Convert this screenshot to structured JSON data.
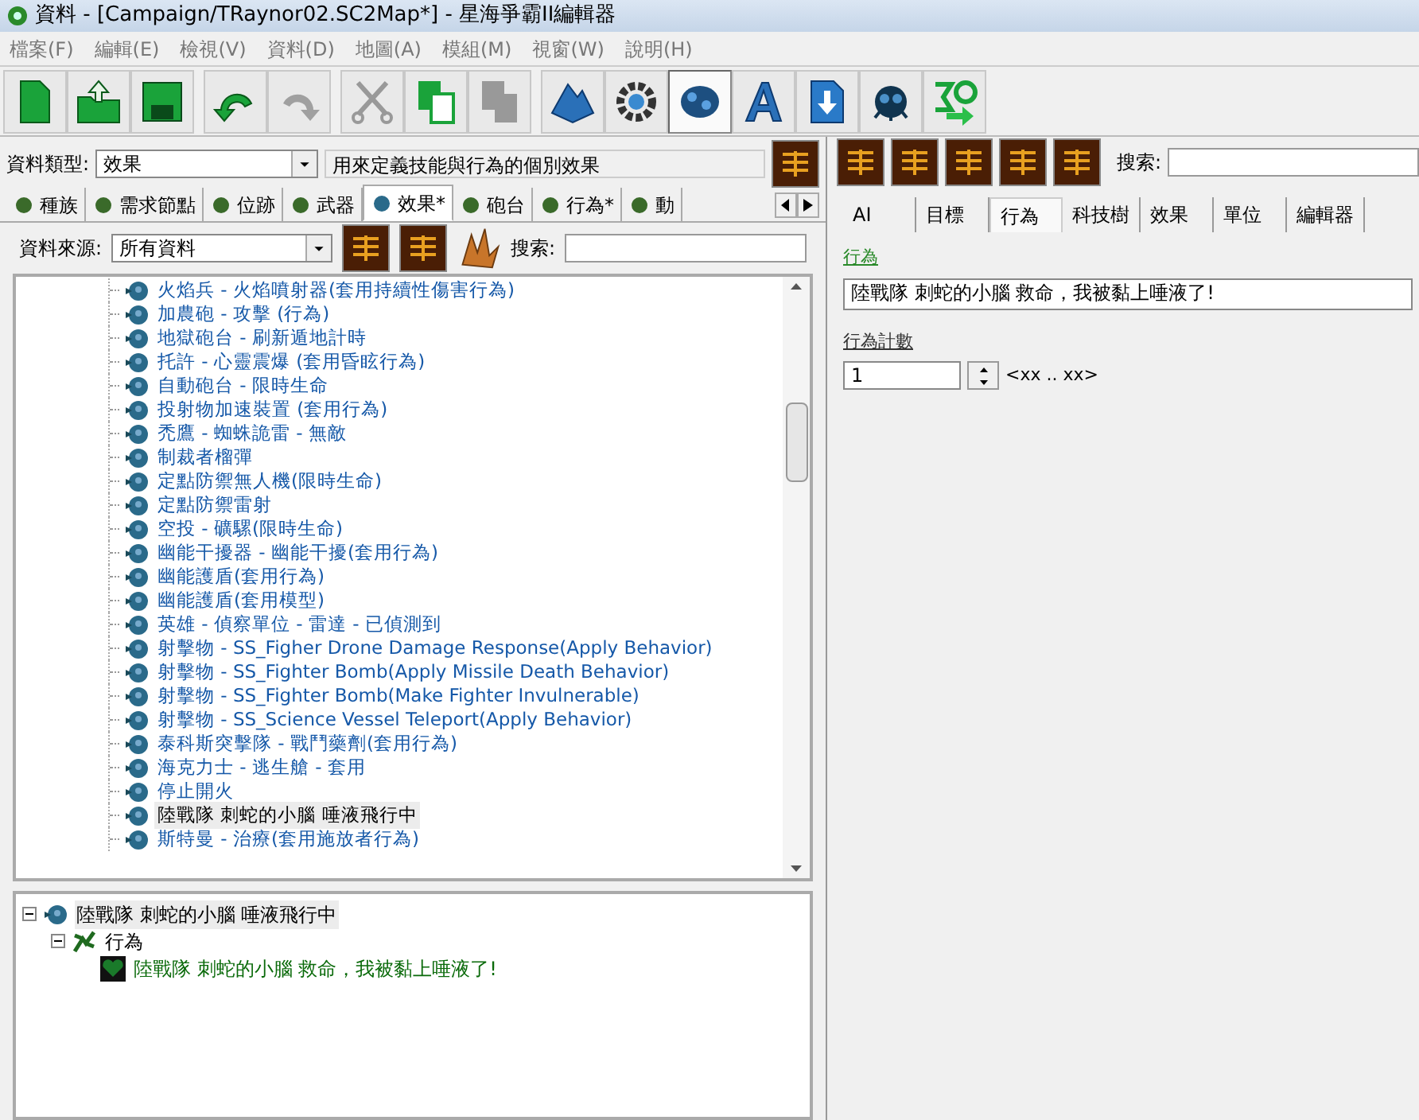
{
  "window": {
    "title": "資料 - [Campaign/TRaynor02.SC2Map*] - 星海爭霸II編輯器"
  },
  "menu": [
    "檔案(F)",
    "編輯(E)",
    "檢視(V)",
    "資料(D)",
    "地圖(A)",
    "模組(M)",
    "視窗(W)",
    "說明(H)"
  ],
  "toolbar": [
    {
      "kind": "new",
      "selected": false
    },
    {
      "kind": "open",
      "selected": false
    },
    {
      "kind": "save",
      "selected": false
    },
    {
      "kind": "undo",
      "selected": false
    },
    {
      "kind": "redo",
      "selected": false
    },
    {
      "kind": "cut",
      "selected": false
    },
    {
      "kind": "copy",
      "selected": false
    },
    {
      "kind": "paste",
      "selected": false
    },
    {
      "kind": "terrain",
      "selected": false
    },
    {
      "kind": "trigger",
      "selected": false
    },
    {
      "kind": "data",
      "selected": true
    },
    {
      "kind": "text",
      "selected": false
    },
    {
      "kind": "import",
      "selected": false
    },
    {
      "kind": "ai",
      "selected": false
    },
    {
      "kind": "launch",
      "selected": false
    }
  ],
  "data_type": {
    "label": "資料類型:",
    "value": "效果",
    "description": "用來定義技能與行為的個別效果"
  },
  "type_tabs": [
    {
      "label": "種族",
      "selected": false
    },
    {
      "label": "需求節點",
      "selected": false
    },
    {
      "label": "位跡",
      "selected": false
    },
    {
      "label": "武器",
      "selected": false
    },
    {
      "label": "效果*",
      "selected": true
    },
    {
      "label": "砲台",
      "selected": false
    },
    {
      "label": "行為*",
      "selected": false
    },
    {
      "label": "動",
      "selected": false
    }
  ],
  "data_source": {
    "label": "資料來源:",
    "value": "所有資料",
    "search_label": "搜索:"
  },
  "effect_list": [
    {
      "label": "火焰兵 - 火焰噴射器(套用持續性傷害行為)",
      "selected": false
    },
    {
      "label": "加農砲 - 攻擊 (行為)",
      "selected": false
    },
    {
      "label": "地獄砲台 - 刷新遁地計時",
      "selected": false
    },
    {
      "label": "托許 - 心靈震爆 (套用昏眩行為)",
      "selected": false
    },
    {
      "label": "自動砲台 - 限時生命",
      "selected": false
    },
    {
      "label": "投射物加速裝置 (套用行為)",
      "selected": false
    },
    {
      "label": "禿鷹 - 蜘蛛詭雷 - 無敵",
      "selected": false
    },
    {
      "label": "制裁者榴彈",
      "selected": false
    },
    {
      "label": "定點防禦無人機(限時生命)",
      "selected": false
    },
    {
      "label": "定點防禦雷射",
      "selected": false
    },
    {
      "label": "空投 - 礦騾(限時生命)",
      "selected": false
    },
    {
      "label": "幽能干擾器 - 幽能干擾(套用行為)",
      "selected": false
    },
    {
      "label": "幽能護盾(套用行為)",
      "selected": false
    },
    {
      "label": "幽能護盾(套用模型)",
      "selected": false
    },
    {
      "label": "英雄 - 偵察單位 - 雷達 - 已偵測到",
      "selected": false
    },
    {
      "label": "射擊物 - SS_Figher Drone Damage Response(Apply Behavior)",
      "selected": false
    },
    {
      "label": "射擊物 - SS_Fighter Bomb(Apply Missile Death Behavior)",
      "selected": false
    },
    {
      "label": "射擊物 - SS_Fighter Bomb(Make Fighter Invulnerable)",
      "selected": false
    },
    {
      "label": "射擊物 - SS_Science Vessel Teleport(Apply Behavior)",
      "selected": false
    },
    {
      "label": "泰科斯突擊隊 - 戰鬥藥劑(套用行為)",
      "selected": false
    },
    {
      "label": "海克力士 - 逃生艙 - 套用",
      "selected": false
    },
    {
      "label": "停止開火",
      "selected": false
    },
    {
      "label": "陸戰隊 刺蛇的小腦 唾液飛行中",
      "selected": true
    },
    {
      "label": "斯特曼 - 治療(套用施放者行為)",
      "selected": false
    }
  ],
  "detail_tree": {
    "label": "陸戰隊 刺蛇的小腦 唾液飛行中",
    "kind": "effect",
    "selected": true,
    "expanded": true,
    "children": [
      {
        "label": "行為",
        "kind": "category",
        "selected": false,
        "expanded": true,
        "children": [
          {
            "label": "陸戰隊 刺蛇的小腦 救命，我被黏上唾液了!",
            "kind": "behavior",
            "selected": false
          }
        ]
      }
    ]
  },
  "right_panel": {
    "search_label": "搜索:",
    "tabs": [
      {
        "label": "AI",
        "selected": false
      },
      {
        "label": "目標",
        "selected": false
      },
      {
        "label": "行為",
        "selected": true
      },
      {
        "label": "科技樹",
        "selected": false
      },
      {
        "label": "效果",
        "selected": false
      },
      {
        "label": "單位",
        "selected": false
      },
      {
        "label": "編輯器",
        "selected": false
      }
    ],
    "behavior_label": "行為",
    "behavior_value": "陸戰隊 刺蛇的小腦 救命，我被黏上唾液了!",
    "count_label": "行為計數",
    "count_value": "1",
    "count_range": "<xx .. xx>"
  }
}
